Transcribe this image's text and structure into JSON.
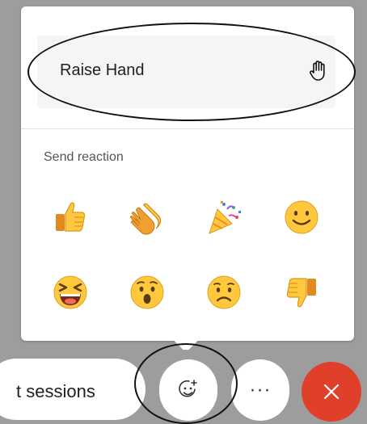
{
  "menu": {
    "raise_hand_label": "Raise Hand",
    "section_label": "Send reaction",
    "reactions": [
      {
        "icon": "thumbs-up-icon"
      },
      {
        "icon": "clapping-hands-icon"
      },
      {
        "icon": "party-popper-icon"
      },
      {
        "icon": "smiling-face-icon"
      },
      {
        "icon": "laughing-face-icon"
      },
      {
        "icon": "surprised-face-icon"
      },
      {
        "icon": "sad-face-icon"
      },
      {
        "icon": "thumbs-down-icon"
      }
    ]
  },
  "toolbar": {
    "sessions_label": "t sessions",
    "more_label": "···",
    "close_color": "#e0402a"
  },
  "colors": {
    "panel_bg": "#ffffff",
    "raise_row_bg": "#f5f5f5",
    "backdrop": "#9d9d9d",
    "emoji_yellow": "#ffc83d"
  }
}
